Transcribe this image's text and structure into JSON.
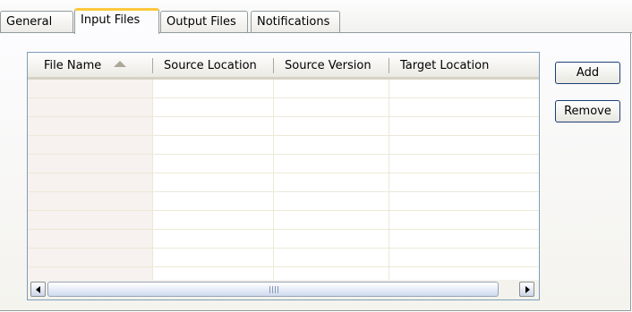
{
  "tabs": [
    {
      "label": "General"
    },
    {
      "label": "Input Files",
      "active": true
    },
    {
      "label": "Output Files"
    },
    {
      "label": "Notifications"
    }
  ],
  "table": {
    "columns": [
      "File Name",
      "Source Location",
      "Source Version",
      "Target Location"
    ],
    "sort_column": "File Name",
    "sort_direction": "ascending",
    "rows": []
  },
  "buttons": {
    "add_label": "Add",
    "remove_label": "Remove"
  },
  "colors": {
    "active_tab_accent": "#ffc83c",
    "border": "#7f9db9",
    "sorted_column_bg": "#f7f1ef"
  }
}
